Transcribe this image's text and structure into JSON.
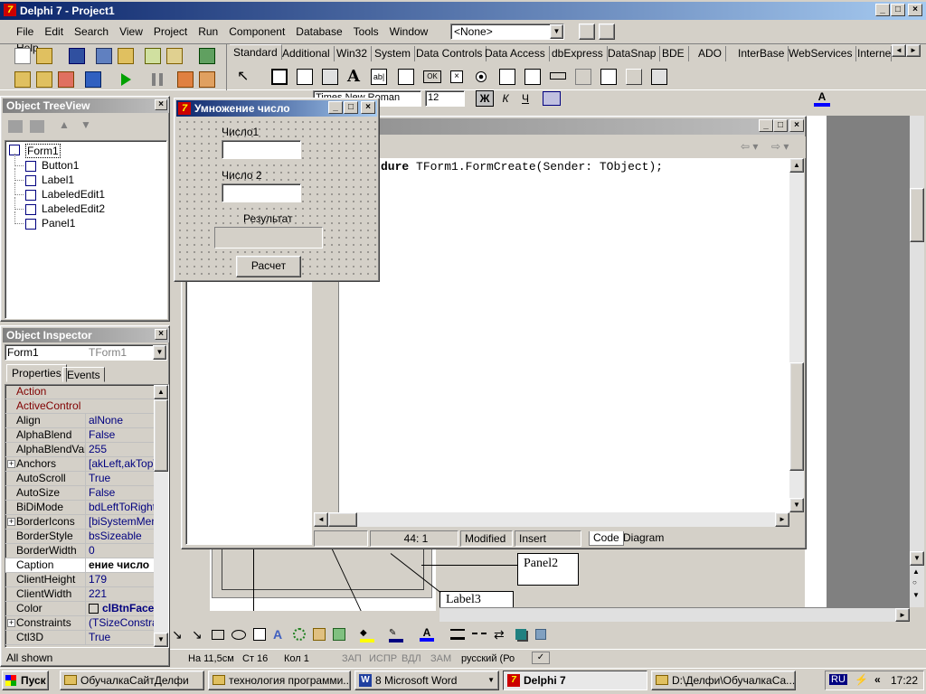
{
  "app": {
    "title": "Delphi 7 - Project1",
    "menu": [
      "File",
      "Edit",
      "Search",
      "View",
      "Project",
      "Run",
      "Component",
      "Database",
      "Tools",
      "Window",
      "Help"
    ],
    "config_combo": "<None>"
  },
  "palette_tabs": [
    "Standard",
    "Additional",
    "Win32",
    "System",
    "Data Controls",
    "Data Access",
    "dbExpress",
    "DataSnap",
    "BDE",
    "ADO",
    "InterBase",
    "WebServices",
    "InternetE"
  ],
  "treeview": {
    "title": "Object TreeView",
    "root": "Form1",
    "children": [
      "Button1",
      "Label1",
      "LabeledEdit1",
      "LabeledEdit2",
      "Panel1"
    ]
  },
  "inspector": {
    "title": "Object Inspector",
    "object_name": "Form1",
    "object_type": "TForm1",
    "tabs": [
      "Properties",
      "Events"
    ],
    "rows": [
      {
        "name": "Action",
        "value": "",
        "red": true
      },
      {
        "name": "ActiveControl",
        "value": "",
        "red": true
      },
      {
        "name": "Align",
        "value": "alNone"
      },
      {
        "name": "AlphaBlend",
        "value": "False"
      },
      {
        "name": "AlphaBlendValu",
        "value": "255"
      },
      {
        "name": "Anchors",
        "value": "[akLeft,akTop]",
        "plus": true
      },
      {
        "name": "AutoScroll",
        "value": "True"
      },
      {
        "name": "AutoSize",
        "value": "False"
      },
      {
        "name": "BiDiMode",
        "value": "bdLeftToRight"
      },
      {
        "name": "BorderIcons",
        "value": "[biSystemMenu,",
        "plus": true
      },
      {
        "name": "BorderStyle",
        "value": "bsSizeable"
      },
      {
        "name": "BorderWidth",
        "value": "0"
      },
      {
        "name": "Caption",
        "value": "ение число",
        "selected": true
      },
      {
        "name": "ClientHeight",
        "value": "179"
      },
      {
        "name": "ClientWidth",
        "value": "221"
      },
      {
        "name": "Color",
        "value": "clBtnFace",
        "swatch": true
      },
      {
        "name": "Constraints",
        "value": "(TSizeConstrain",
        "plus": true
      },
      {
        "name": "Ctl3D",
        "value": "True"
      }
    ],
    "footer": "All shown"
  },
  "form": {
    "title": "Умножение число",
    "label1": "Число1",
    "label2": "Число 2",
    "result_label": "Результат",
    "button": "Расчет"
  },
  "editor": {
    "code_line": "dure TForm1.FormCreate(Sender: TObject);",
    "status_pos": "44:  1",
    "status_modified": "Modified",
    "status_insert": "Insert",
    "tab_code": "Code",
    "tab_diagram": "Diagram"
  },
  "word_doc": {
    "font_name": "Times New Roman",
    "font_size": "12",
    "panel_label": "Panel2",
    "label_label": "Label3",
    "status": {
      "pos": "На 11,5см",
      "line": "Ст 16",
      "col": "Кол 1",
      "rec": "ЗАП",
      "trk": "ИСПР",
      "ext": "ВДЛ",
      "ovr": "ЗАМ",
      "lang": "русский (Ро"
    }
  },
  "taskbar": {
    "start": "Пуск",
    "buttons": [
      "ОбучалкаСайтДелфи",
      "технология программи...",
      "8 Microsoft Word",
      "Delphi 7",
      "D:\\Делфи\\ОбучалкаСа..."
    ],
    "lang": "RU",
    "clock": "17:22"
  }
}
